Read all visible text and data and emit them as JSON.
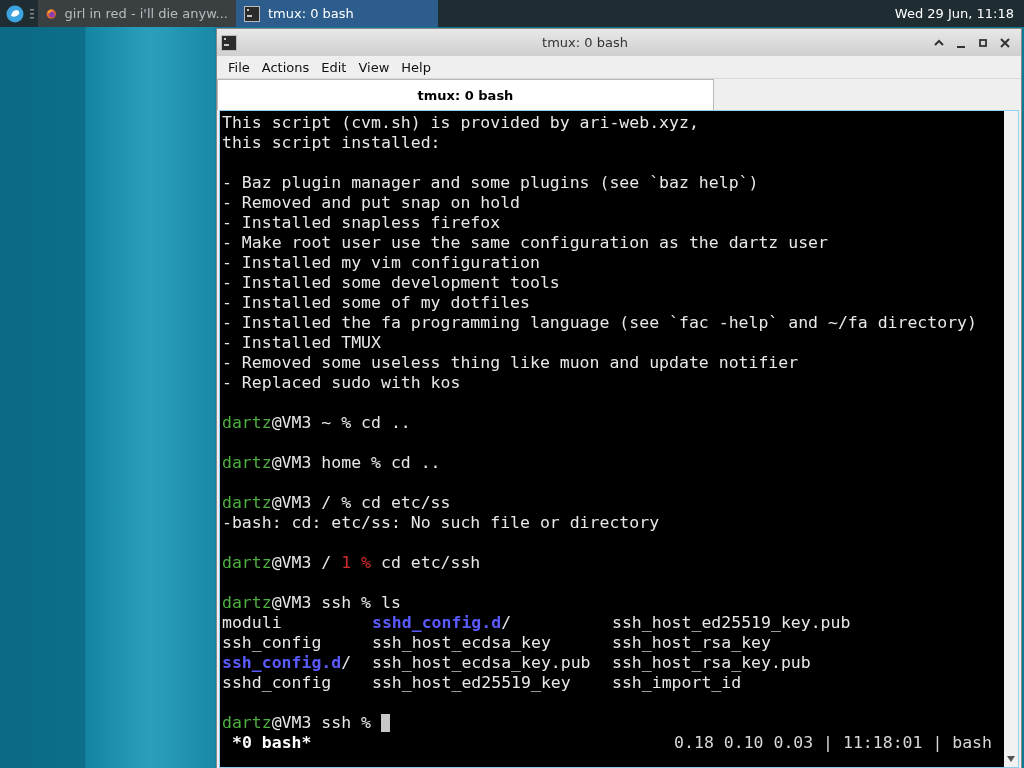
{
  "taskbar": {
    "tasks": [
      {
        "kind": "browser",
        "label": "girl in red - i'll die anyw...",
        "selected": false
      },
      {
        "kind": "terminal",
        "label": "tmux: 0 bash",
        "selected": true
      }
    ],
    "clock": "Wed 29 Jun, 11:18"
  },
  "window": {
    "title": "tmux: 0 bash",
    "menu": [
      "File",
      "Actions",
      "Edit",
      "View",
      "Help"
    ],
    "tabs": [
      {
        "label": "tmux: 0 bash",
        "selected": true
      }
    ],
    "terminal": {
      "lines": [
        {
          "kind": "text",
          "segments": [
            {
              "kind": "plain",
              "text": "This script (cvm.sh) is provided by ari-web.xyz,"
            }
          ]
        },
        {
          "kind": "text",
          "segments": [
            {
              "kind": "plain",
              "text": "this script installed:"
            }
          ]
        },
        {
          "kind": "blank"
        },
        {
          "kind": "text",
          "segments": [
            {
              "kind": "plain",
              "text": "- Baz plugin manager and some plugins (see `baz help`)"
            }
          ]
        },
        {
          "kind": "text",
          "segments": [
            {
              "kind": "plain",
              "text": "- Removed and put snap on hold"
            }
          ]
        },
        {
          "kind": "text",
          "segments": [
            {
              "kind": "plain",
              "text": "- Installed snapless firefox"
            }
          ]
        },
        {
          "kind": "text",
          "segments": [
            {
              "kind": "plain",
              "text": "- Make root user use the same configuration as the dartz user"
            }
          ]
        },
        {
          "kind": "text",
          "segments": [
            {
              "kind": "plain",
              "text": "- Installed my vim configuration"
            }
          ]
        },
        {
          "kind": "text",
          "segments": [
            {
              "kind": "plain",
              "text": "- Installed some development tools"
            }
          ]
        },
        {
          "kind": "text",
          "segments": [
            {
              "kind": "plain",
              "text": "- Installed some of my dotfiles"
            }
          ]
        },
        {
          "kind": "text",
          "segments": [
            {
              "kind": "plain",
              "text": "- Installed the fa programming language (see `fac -help` and ~/fa directory)"
            }
          ]
        },
        {
          "kind": "text",
          "segments": [
            {
              "kind": "plain",
              "text": "- Installed TMUX"
            }
          ]
        },
        {
          "kind": "text",
          "segments": [
            {
              "kind": "plain",
              "text": "- Removed some useless thing like muon and update notifier"
            }
          ]
        },
        {
          "kind": "text",
          "segments": [
            {
              "kind": "plain",
              "text": "- Replaced sudo with kos"
            }
          ]
        },
        {
          "kind": "blank"
        },
        {
          "kind": "text",
          "segments": [
            {
              "kind": "user",
              "text": "dartz"
            },
            {
              "kind": "plain",
              "text": "@VM3 ~ % cd .."
            }
          ]
        },
        {
          "kind": "blank"
        },
        {
          "kind": "text",
          "segments": [
            {
              "kind": "user",
              "text": "dartz"
            },
            {
              "kind": "plain",
              "text": "@VM3 home % cd .."
            }
          ]
        },
        {
          "kind": "blank"
        },
        {
          "kind": "text",
          "segments": [
            {
              "kind": "user",
              "text": "dartz"
            },
            {
              "kind": "plain",
              "text": "@VM3 / % cd etc/ss"
            }
          ]
        },
        {
          "kind": "text",
          "segments": [
            {
              "kind": "plain",
              "text": "-bash: cd: etc/ss: No such file or directory"
            }
          ]
        },
        {
          "kind": "blank"
        },
        {
          "kind": "text",
          "segments": [
            {
              "kind": "user",
              "text": "dartz"
            },
            {
              "kind": "plain",
              "text": "@VM3 / "
            },
            {
              "kind": "error",
              "text": "1 %"
            },
            {
              "kind": "plain",
              "text": " cd etc/ssh"
            }
          ]
        },
        {
          "kind": "blank"
        },
        {
          "kind": "text",
          "segments": [
            {
              "kind": "user",
              "text": "dartz"
            },
            {
              "kind": "plain",
              "text": "@VM3 ssh % ls"
            }
          ]
        },
        {
          "kind": "listing",
          "rows": [
            [
              {
                "kind": "file",
                "name": "moduli"
              },
              {
                "kind": "dir",
                "name": "sshd_config.d",
                "suffix": "/"
              },
              {
                "kind": "file",
                "name": "ssh_host_ed25519_key.pub"
              }
            ],
            [
              {
                "kind": "file",
                "name": "ssh_config"
              },
              {
                "kind": "file",
                "name": "ssh_host_ecdsa_key"
              },
              {
                "kind": "file",
                "name": "ssh_host_rsa_key"
              }
            ],
            [
              {
                "kind": "dir",
                "name": "ssh_config.d",
                "suffix": "/"
              },
              {
                "kind": "file",
                "name": "ssh_host_ecdsa_key.pub"
              },
              {
                "kind": "file",
                "name": "ssh_host_rsa_key.pub"
              }
            ],
            [
              {
                "kind": "file",
                "name": "sshd_config"
              },
              {
                "kind": "file",
                "name": "ssh_host_ed25519_key"
              },
              {
                "kind": "file",
                "name": "ssh_import_id"
              }
            ]
          ]
        },
        {
          "kind": "blank"
        },
        {
          "kind": "text",
          "cursor": true,
          "segments": [
            {
              "kind": "user",
              "text": "dartz"
            },
            {
              "kind": "plain",
              "text": "@VM3 ssh % "
            }
          ]
        }
      ],
      "status_bar": {
        "left": "*0 bash*",
        "right": "0.18 0.10 0.03 | 11:18:01 | bash"
      }
    }
  }
}
